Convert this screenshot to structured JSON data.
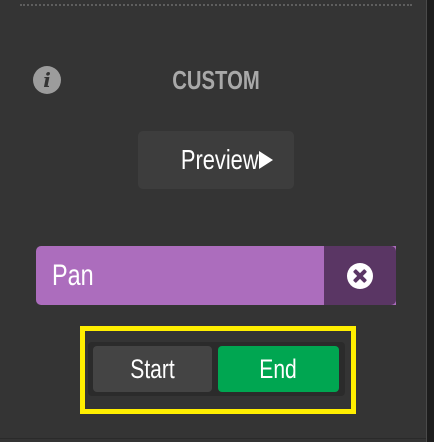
{
  "panel": {
    "title": "CUSTOM",
    "info_icon": "info-icon",
    "preview_label": "Preview",
    "preview_icon": "play-icon"
  },
  "tag": {
    "label": "Pan",
    "clear_icon": "close-circle-icon",
    "color": "#ac6dbd",
    "clear_color": "#5a3664"
  },
  "toggle": {
    "start_label": "Start",
    "end_label": "End",
    "selected": "End",
    "selected_color": "#00a651",
    "highlight_color": "#ffee00"
  }
}
